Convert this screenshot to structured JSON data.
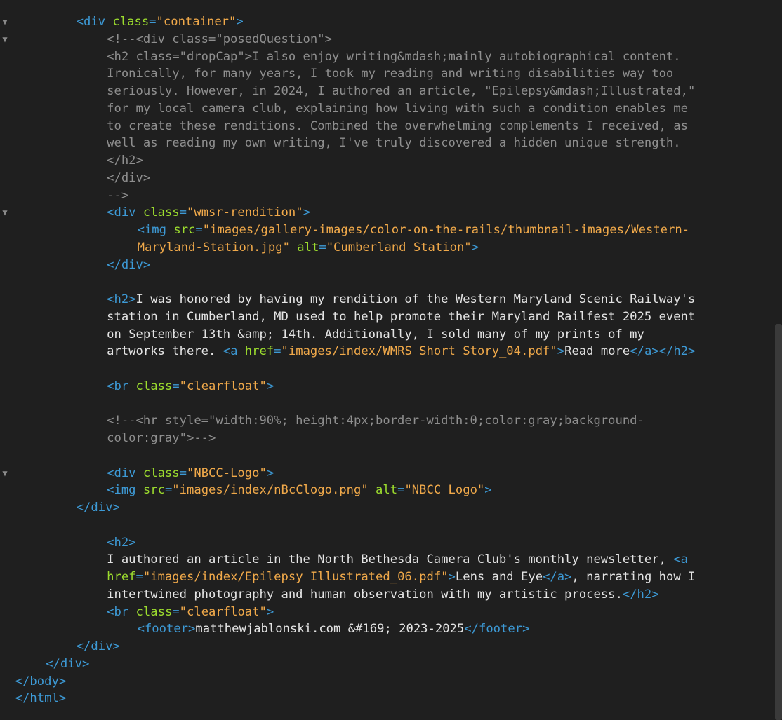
{
  "fold_marker": "▼",
  "lines": [
    {
      "fold": true,
      "indent": 5,
      "tokens": [
        [
          "tag",
          "<div "
        ],
        [
          "attr",
          "class"
        ],
        [
          "tag",
          "="
        ],
        [
          "str",
          "\"container\""
        ],
        [
          "tag",
          ">"
        ]
      ]
    },
    {
      "fold": true,
      "indent": 7,
      "tokens": [
        [
          "cmt",
          "<!--<div class=\"posedQuestion\">"
        ]
      ]
    },
    {
      "fold": false,
      "indent": 7,
      "tokens": [
        [
          "cmt",
          "<h2 class=\"dropCap\">I also enjoy writing&mdash;mainly autobiographical content."
        ]
      ]
    },
    {
      "fold": false,
      "indent": 7,
      "tokens": [
        [
          "cmt",
          "Ironically, for many years, I took my reading and writing disabilities way too"
        ]
      ]
    },
    {
      "fold": false,
      "indent": 7,
      "tokens": [
        [
          "cmt",
          "seriously. However, in 2024, I authored an article, \"Epilepsy&mdash;Illustrated,\""
        ]
      ]
    },
    {
      "fold": false,
      "indent": 7,
      "tokens": [
        [
          "cmt",
          "for my local camera club, explaining how living with such a condition enables me"
        ]
      ]
    },
    {
      "fold": false,
      "indent": 7,
      "tokens": [
        [
          "cmt",
          "to create these renditions. Combined the overwhelming complements I received, as"
        ]
      ]
    },
    {
      "fold": false,
      "indent": 7,
      "tokens": [
        [
          "cmt",
          "well as reading my own writing, I've truly discovered a hidden unique strength."
        ]
      ]
    },
    {
      "fold": false,
      "indent": 7,
      "tokens": [
        [
          "cmt",
          "</h2>"
        ]
      ]
    },
    {
      "fold": false,
      "indent": 7,
      "tokens": [
        [
          "cmt",
          "</div>"
        ]
      ]
    },
    {
      "fold": false,
      "indent": 7,
      "tokens": [
        [
          "cmt",
          "-->"
        ]
      ]
    },
    {
      "fold": true,
      "indent": 7,
      "tokens": [
        [
          "tag",
          "<div "
        ],
        [
          "attr",
          "class"
        ],
        [
          "tag",
          "="
        ],
        [
          "str",
          "\"wmsr-rendition\""
        ],
        [
          "tag",
          ">"
        ]
      ]
    },
    {
      "fold": false,
      "indent": 9,
      "tokens": [
        [
          "tag",
          "<img "
        ],
        [
          "attr",
          "src"
        ],
        [
          "tag",
          "="
        ],
        [
          "str",
          "\"images/gallery-images/color-on-the-rails/thumbnail-images/Western-"
        ]
      ]
    },
    {
      "fold": false,
      "indent": 9,
      "tokens": [
        [
          "str",
          "Maryland-Station.jpg\""
        ],
        [
          "txt",
          " "
        ],
        [
          "attr",
          "alt"
        ],
        [
          "tag",
          "="
        ],
        [
          "str",
          "\"Cumberland Station\""
        ],
        [
          "tag",
          ">"
        ]
      ]
    },
    {
      "fold": false,
      "indent": 7,
      "tokens": [
        [
          "tag",
          "</div>"
        ]
      ]
    },
    {
      "fold": false,
      "indent": 0,
      "tokens": []
    },
    {
      "fold": false,
      "indent": 7,
      "tokens": [
        [
          "tag",
          "<h2>"
        ],
        [
          "txt",
          "I was honored by having my rendition of the Western Maryland Scenic Railway's"
        ]
      ]
    },
    {
      "fold": false,
      "indent": 7,
      "tokens": [
        [
          "txt",
          "station in Cumberland, MD used to help promote their Maryland Railfest 2025 event"
        ]
      ]
    },
    {
      "fold": false,
      "indent": 7,
      "tokens": [
        [
          "txt",
          "on September 13th &amp; 14th. Additionally, I sold many of my prints of my"
        ]
      ]
    },
    {
      "fold": false,
      "indent": 7,
      "tokens": [
        [
          "txt",
          "artworks there. "
        ],
        [
          "tag",
          "<a "
        ],
        [
          "attr",
          "href"
        ],
        [
          "tag",
          "="
        ],
        [
          "str",
          "\"images/index/WMRS Short Story_04.pdf\""
        ],
        [
          "tag",
          ">"
        ],
        [
          "txt",
          "Read more"
        ],
        [
          "tag",
          "</a></h2>"
        ]
      ]
    },
    {
      "fold": false,
      "indent": 0,
      "tokens": []
    },
    {
      "fold": false,
      "indent": 7,
      "tokens": [
        [
          "tag",
          "<br "
        ],
        [
          "attr",
          "class"
        ],
        [
          "tag",
          "="
        ],
        [
          "str",
          "\"clearfloat\""
        ],
        [
          "tag",
          ">"
        ]
      ]
    },
    {
      "fold": false,
      "indent": 0,
      "tokens": []
    },
    {
      "fold": false,
      "indent": 7,
      "tokens": [
        [
          "cmt",
          "<!--<hr style=\"width:90%; height:4px;border-width:0;color:gray;background-"
        ]
      ]
    },
    {
      "fold": false,
      "indent": 7,
      "tokens": [
        [
          "cmt",
          "color:gray\">-->"
        ]
      ]
    },
    {
      "fold": false,
      "indent": 0,
      "tokens": []
    },
    {
      "fold": true,
      "indent": 7,
      "tokens": [
        [
          "tag",
          "<div "
        ],
        [
          "attr",
          "class"
        ],
        [
          "tag",
          "="
        ],
        [
          "str",
          "\"NBCC-Logo\""
        ],
        [
          "tag",
          ">"
        ]
      ]
    },
    {
      "fold": false,
      "indent": 7,
      "tokens": [
        [
          "tag",
          "<img "
        ],
        [
          "attr",
          "src"
        ],
        [
          "tag",
          "="
        ],
        [
          "str",
          "\"images/index/nBcClogo.png\""
        ],
        [
          "txt",
          " "
        ],
        [
          "attr",
          "alt"
        ],
        [
          "tag",
          "="
        ],
        [
          "str",
          "\"NBCC Logo\""
        ],
        [
          "tag",
          ">"
        ]
      ]
    },
    {
      "fold": false,
      "indent": 5,
      "tokens": [
        [
          "tag",
          "</div>"
        ]
      ]
    },
    {
      "fold": false,
      "indent": 0,
      "tokens": []
    },
    {
      "fold": false,
      "indent": 7,
      "tokens": [
        [
          "tag",
          "<h2>"
        ]
      ]
    },
    {
      "fold": false,
      "indent": 7,
      "tokens": [
        [
          "txt",
          "I authored an article in the North Bethesda Camera Club's monthly newsletter, "
        ],
        [
          "tag",
          "<a"
        ]
      ]
    },
    {
      "fold": false,
      "indent": 7,
      "tokens": [
        [
          "attr",
          "href"
        ],
        [
          "tag",
          "="
        ],
        [
          "str",
          "\"images/index/Epilepsy Illustrated_06.pdf\""
        ],
        [
          "tag",
          ">"
        ],
        [
          "txt",
          "Lens and Eye"
        ],
        [
          "tag",
          "</a>"
        ],
        [
          "txt",
          ", narrating how I"
        ]
      ]
    },
    {
      "fold": false,
      "indent": 7,
      "tokens": [
        [
          "txt",
          "intertwined photography and human observation with my artistic process."
        ],
        [
          "tag",
          "</h2>"
        ]
      ]
    },
    {
      "fold": false,
      "indent": 7,
      "tokens": [
        [
          "tag",
          "<br "
        ],
        [
          "attr",
          "class"
        ],
        [
          "tag",
          "="
        ],
        [
          "str",
          "\"clearfloat\""
        ],
        [
          "tag",
          ">"
        ]
      ]
    },
    {
      "fold": false,
      "indent": 9,
      "tokens": [
        [
          "tag",
          "<footer>"
        ],
        [
          "txt",
          "matthewjablonski.com &#169; 2023-2025"
        ],
        [
          "tag",
          "</footer>"
        ]
      ]
    },
    {
      "fold": false,
      "indent": 5,
      "tokens": [
        [
          "tag",
          "</div>"
        ]
      ]
    },
    {
      "fold": false,
      "indent": 3,
      "tokens": [
        [
          "tag",
          "</div>"
        ]
      ]
    },
    {
      "fold": false,
      "indent": 1,
      "tokens": [
        [
          "tag",
          "</body>"
        ]
      ]
    },
    {
      "fold": false,
      "indent": 1,
      "tokens": [
        [
          "tag",
          "</html>"
        ]
      ]
    }
  ]
}
